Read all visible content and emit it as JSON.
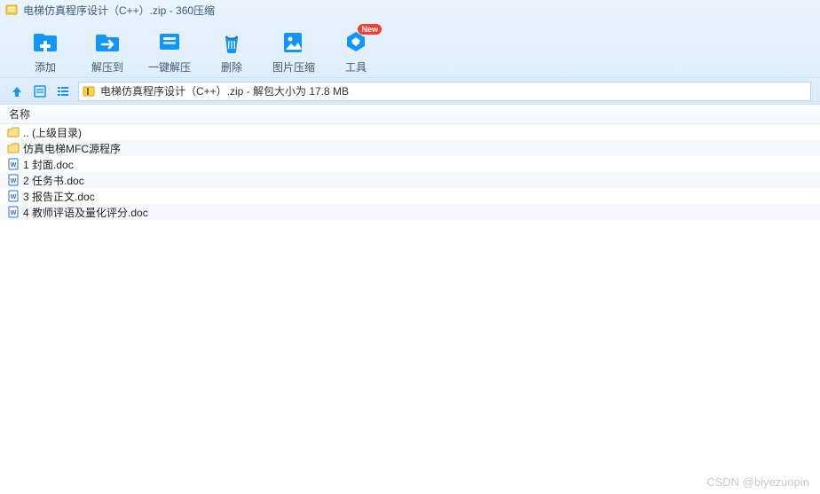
{
  "title": "电梯仿真程序设计（C++）.zip - 360压缩",
  "toolbar": {
    "add": "添加",
    "extract_to": "解压到",
    "quick_extract": "一键解压",
    "delete": "删除",
    "image_compress": "图片压缩",
    "tools": "工具",
    "new_badge": "New"
  },
  "path": "电梯仿真程序设计（C++）.zip - 解包大小为 17.8 MB",
  "columns": {
    "name": "名称"
  },
  "files": [
    {
      "name": ".. (上级目录)",
      "type": "up"
    },
    {
      "name": "仿真电梯MFC源程序",
      "type": "folder"
    },
    {
      "name": "1 封面.doc",
      "type": "doc"
    },
    {
      "name": "2 任务书.doc",
      "type": "doc"
    },
    {
      "name": "3 报告正文.doc",
      "type": "doc"
    },
    {
      "name": "4 教师评语及量化评分.doc",
      "type": "doc"
    }
  ],
  "watermark": "CSDN @biyezuopin"
}
